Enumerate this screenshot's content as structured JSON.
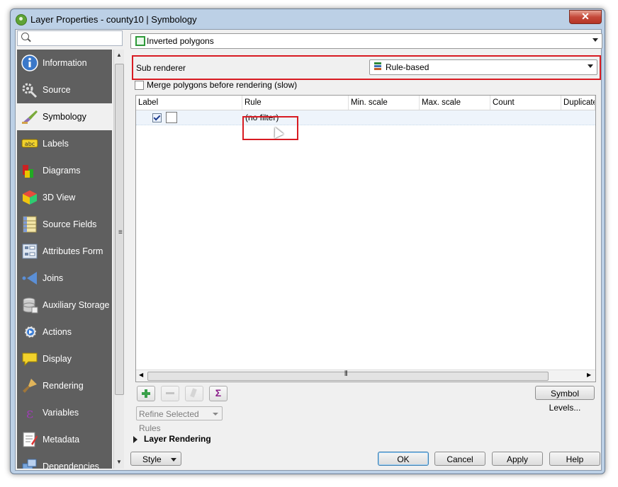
{
  "window": {
    "title": "Layer Properties - county10 | Symbology",
    "close_label": "✕"
  },
  "search": {
    "placeholder": ""
  },
  "sidebar": {
    "items": [
      {
        "label": "Information",
        "icon": "info-icon",
        "active": false
      },
      {
        "label": "Source",
        "icon": "source-icon",
        "active": false
      },
      {
        "label": "Symbology",
        "icon": "symbology-icon",
        "active": true
      },
      {
        "label": "Labels",
        "icon": "labels-icon",
        "active": false
      },
      {
        "label": "Diagrams",
        "icon": "diagrams-icon",
        "active": false
      },
      {
        "label": "3D View",
        "icon": "3d-view-icon",
        "active": false
      },
      {
        "label": "Source Fields",
        "icon": "source-fields-icon",
        "active": false
      },
      {
        "label": "Attributes Form",
        "icon": "attributes-form-icon",
        "active": false
      },
      {
        "label": "Joins",
        "icon": "joins-icon",
        "active": false
      },
      {
        "label": "Auxiliary Storage",
        "icon": "auxiliary-storage-icon",
        "active": false
      },
      {
        "label": "Actions",
        "icon": "actions-icon",
        "active": false
      },
      {
        "label": "Display",
        "icon": "display-icon",
        "active": false
      },
      {
        "label": "Rendering",
        "icon": "rendering-icon",
        "active": false
      },
      {
        "label": "Variables",
        "icon": "variables-icon",
        "active": false
      },
      {
        "label": "Metadata",
        "icon": "metadata-icon",
        "active": false
      },
      {
        "label": "Dependencies",
        "icon": "dependencies-icon",
        "active": false
      }
    ]
  },
  "renderer": {
    "selected": "Inverted polygons"
  },
  "sub_renderer": {
    "label": "Sub renderer",
    "selected": "Rule-based"
  },
  "merge": {
    "label": "Merge polygons before rendering (slow)",
    "checked": false
  },
  "rules_table": {
    "columns": [
      "Label",
      "Rule",
      "Min. scale",
      "Max. scale",
      "Count",
      "Duplicate"
    ],
    "rows": [
      {
        "label": "",
        "rule": "(no filter)",
        "checked": true
      }
    ]
  },
  "toolbar": {
    "add_icon": "add-rule-icon",
    "remove_icon": "remove-rule-icon",
    "edit_icon": "edit-rule-icon",
    "sigma_label": "Σ",
    "symbol_levels_label": "Symbol Levels..."
  },
  "refine": {
    "label": "Refine Selected Rules"
  },
  "layer_rendering": {
    "label": "Layer Rendering"
  },
  "footer": {
    "style_label": "Style",
    "ok_label": "OK",
    "cancel_label": "Cancel",
    "apply_label": "Apply",
    "help_label": "Help"
  },
  "colors": {
    "highlight": "#d81b22",
    "sidebar_bg": "#5f5f5f",
    "accent": "#3c7fb1"
  }
}
